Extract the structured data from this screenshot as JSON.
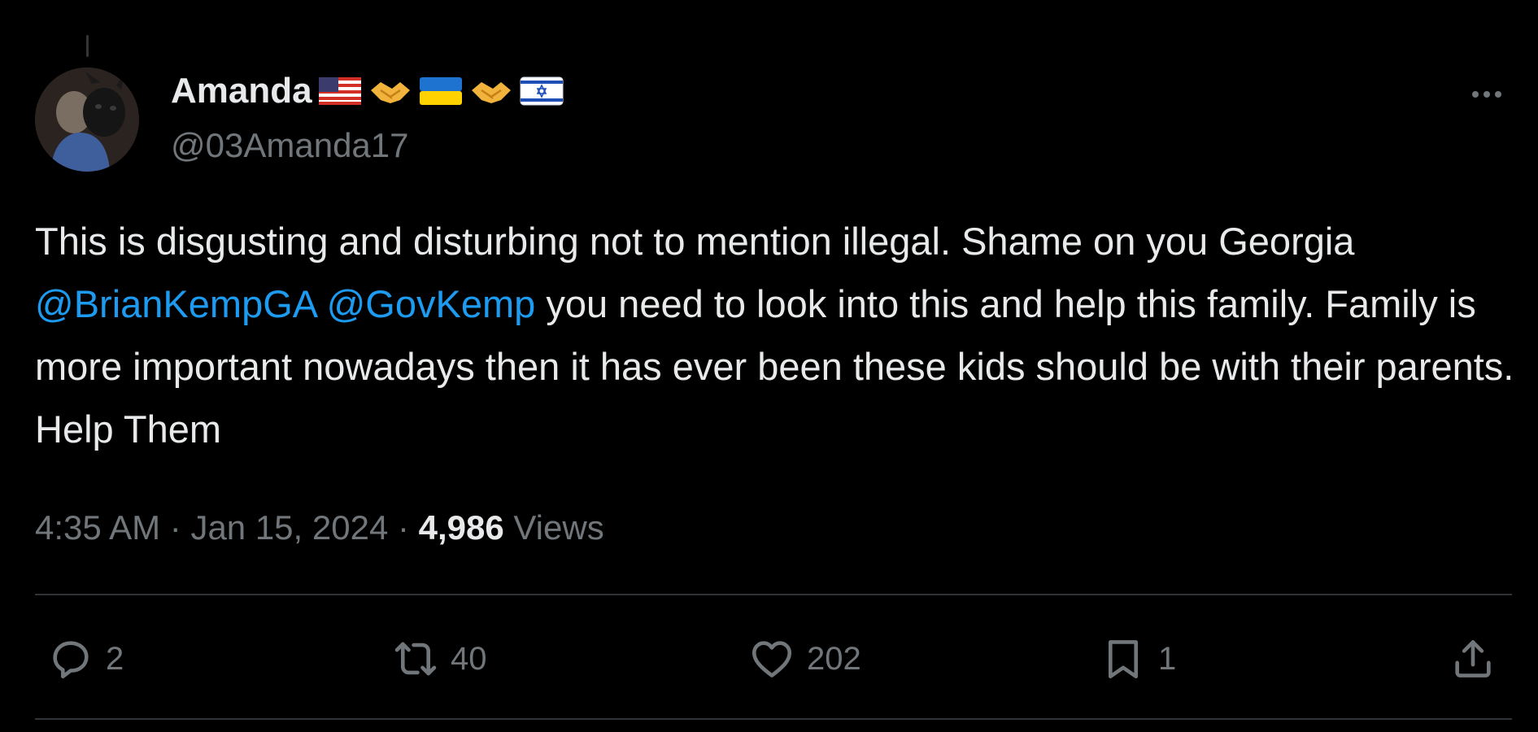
{
  "author": {
    "display_name": "Amanda",
    "handle": "@03Amanda17",
    "name_emojis": [
      "flag-usa-emoji",
      "handshake-emoji",
      "flag-ukraine-emoji",
      "handshake-emoji",
      "flag-israel-emoji"
    ]
  },
  "tweet": {
    "text_parts": {
      "p1": "This is disgusting and disturbing not to mention illegal. Shame on you Georgia ",
      "mention1": "@BrianKempGA",
      "space": " ",
      "mention2": "@GovKemp",
      "p2": " you need to look into this and help this family. Family is more important nowadays then it has ever been these kids should be with their parents. Help Them"
    }
  },
  "meta": {
    "time": "4:35 AM",
    "sep1": " · ",
    "date": "Jan 15, 2024",
    "sep2": " · ",
    "views_count": "4,986",
    "views_label": " Views"
  },
  "actions": {
    "reply_count": "2",
    "retweet_count": "40",
    "like_count": "202",
    "bookmark_count": "1"
  },
  "colors": {
    "background": "#000000",
    "text": "#e7e9ea",
    "secondary": "#71767b",
    "mention": "#1d9bf0",
    "divider": "#2f3336"
  }
}
